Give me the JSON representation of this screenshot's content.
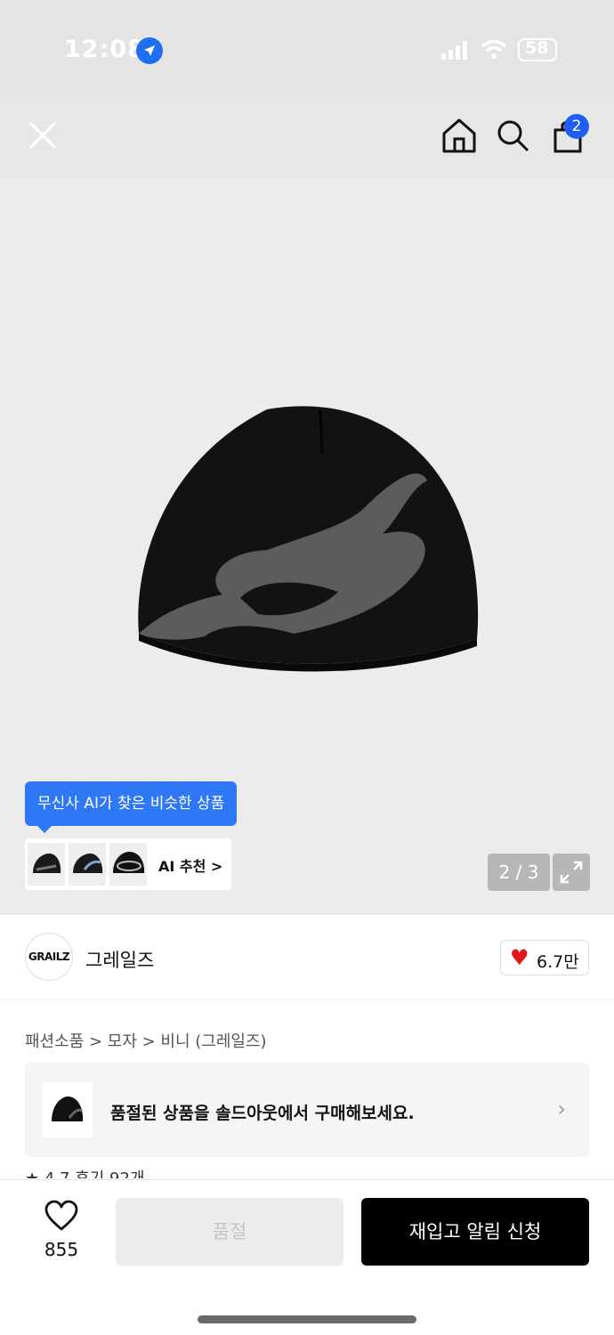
{
  "status_bar": {
    "time": "12:08",
    "battery": "58"
  },
  "nav": {
    "cart_count": "2"
  },
  "gallery": {
    "counter": "2 / 3"
  },
  "ai": {
    "tooltip": "무신사 AI가 찾은 비슷한 상품",
    "label": "AI 추천 >"
  },
  "brand": {
    "logo": "GRAILZ",
    "name": "그레일즈",
    "likes": "6.7만"
  },
  "breadcrumb": "패션소품 > 모자 > 비니 (그레일즈)",
  "soldout_banner": {
    "text": "품절된 상품을 솔드아웃에서 구매해보세요.",
    "arrow": "›"
  },
  "review": {
    "text": "★ 4.7 후기 92개"
  },
  "bottom": {
    "wish_count": "855",
    "soldout_label": "품절",
    "restock_label": "재입고 알림 신청"
  },
  "colors": {
    "accent_blue": "#2f78f5",
    "heart_red": "#e4151b"
  }
}
